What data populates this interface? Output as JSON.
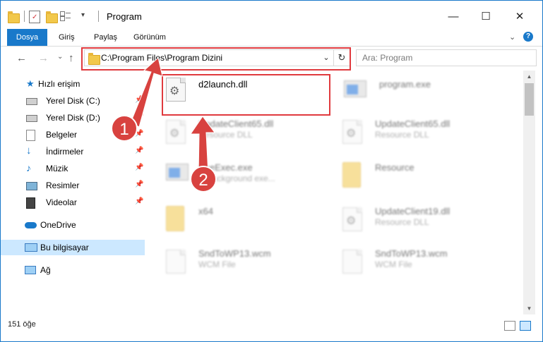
{
  "window": {
    "title": "Program",
    "controls": {
      "minimize": "—",
      "maximize": "☐",
      "close": "✕"
    }
  },
  "ribbon": {
    "tabs": [
      {
        "label": "Dosya"
      },
      {
        "label": "Giriş"
      },
      {
        "label": "Paylaş"
      },
      {
        "label": "Görünüm"
      }
    ],
    "expand_icon": "chevron-down",
    "help": "?"
  },
  "navigation": {
    "back": "←",
    "forward": "→",
    "recent": "⌄",
    "up": "↑",
    "address": "C:\\Program Files\\Program Dizini",
    "dropdown": "⌄",
    "refresh": "↻",
    "search_placeholder": "Ara: Program",
    "search_icon": "⌕"
  },
  "sidebar": {
    "items": [
      {
        "label": "Hızlı erişim",
        "icon": "star-icon",
        "pinned": false
      },
      {
        "label": "Yerel Disk (C:)",
        "icon": "drive-icon",
        "pinned": true
      },
      {
        "label": "Yerel Disk (D:)",
        "icon": "drive-icon",
        "pinned": true
      },
      {
        "label": "Belgeler",
        "icon": "documents-icon",
        "pinned": true
      },
      {
        "label": "İndirmeler",
        "icon": "download-icon",
        "pinned": true
      },
      {
        "label": "Müzik",
        "icon": "music-icon",
        "pinned": true
      },
      {
        "label": "Resimler",
        "icon": "pictures-icon",
        "pinned": true
      },
      {
        "label": "Videolar",
        "icon": "video-icon",
        "pinned": true
      },
      {
        "label": "OneDrive",
        "icon": "cloud-icon",
        "pinned": false
      },
      {
        "label": "Bu bilgisayar",
        "icon": "computer-icon",
        "pinned": false,
        "selected": true
      },
      {
        "label": "Ağ",
        "icon": "network-icon",
        "pinned": false
      }
    ],
    "pin_glyph": "📌"
  },
  "files": [
    {
      "name": "d2launch.dll",
      "type": "",
      "icon": "dll-icon",
      "highlighted": true
    },
    {
      "name": "program.exe",
      "type": "",
      "icon": "exe-icon"
    },
    {
      "name": "UpdateClient65.dll",
      "type": "Resource DLL",
      "icon": "dll-icon"
    },
    {
      "name": "UpdateClient65.dll",
      "type": "Resource DLL",
      "icon": "dll-icon"
    },
    {
      "name": "UseExec.exe",
      "type": "... background exe...",
      "icon": "exe-icon"
    },
    {
      "name": "Resource",
      "type": "",
      "icon": "folder-icon"
    },
    {
      "name": "x64",
      "type": "",
      "icon": "folder-icon"
    },
    {
      "name": "UpdateClient19.dll",
      "type": "Resource DLL",
      "icon": "dll-icon"
    },
    {
      "name": "SndToWP13.wcm",
      "type": "WCM File",
      "icon": "file-icon"
    },
    {
      "name": "SndToWP13.wcm",
      "type": "WCM File",
      "icon": "file-icon"
    }
  ],
  "callouts": [
    {
      "number": "1"
    },
    {
      "number": "2"
    }
  ],
  "status": {
    "item_count": "151 öğe"
  },
  "colors": {
    "accent": "#1979ca",
    "highlight": "#e03a3e",
    "callout_fill": "#d8423f",
    "selected_bg": "#cce8ff"
  }
}
